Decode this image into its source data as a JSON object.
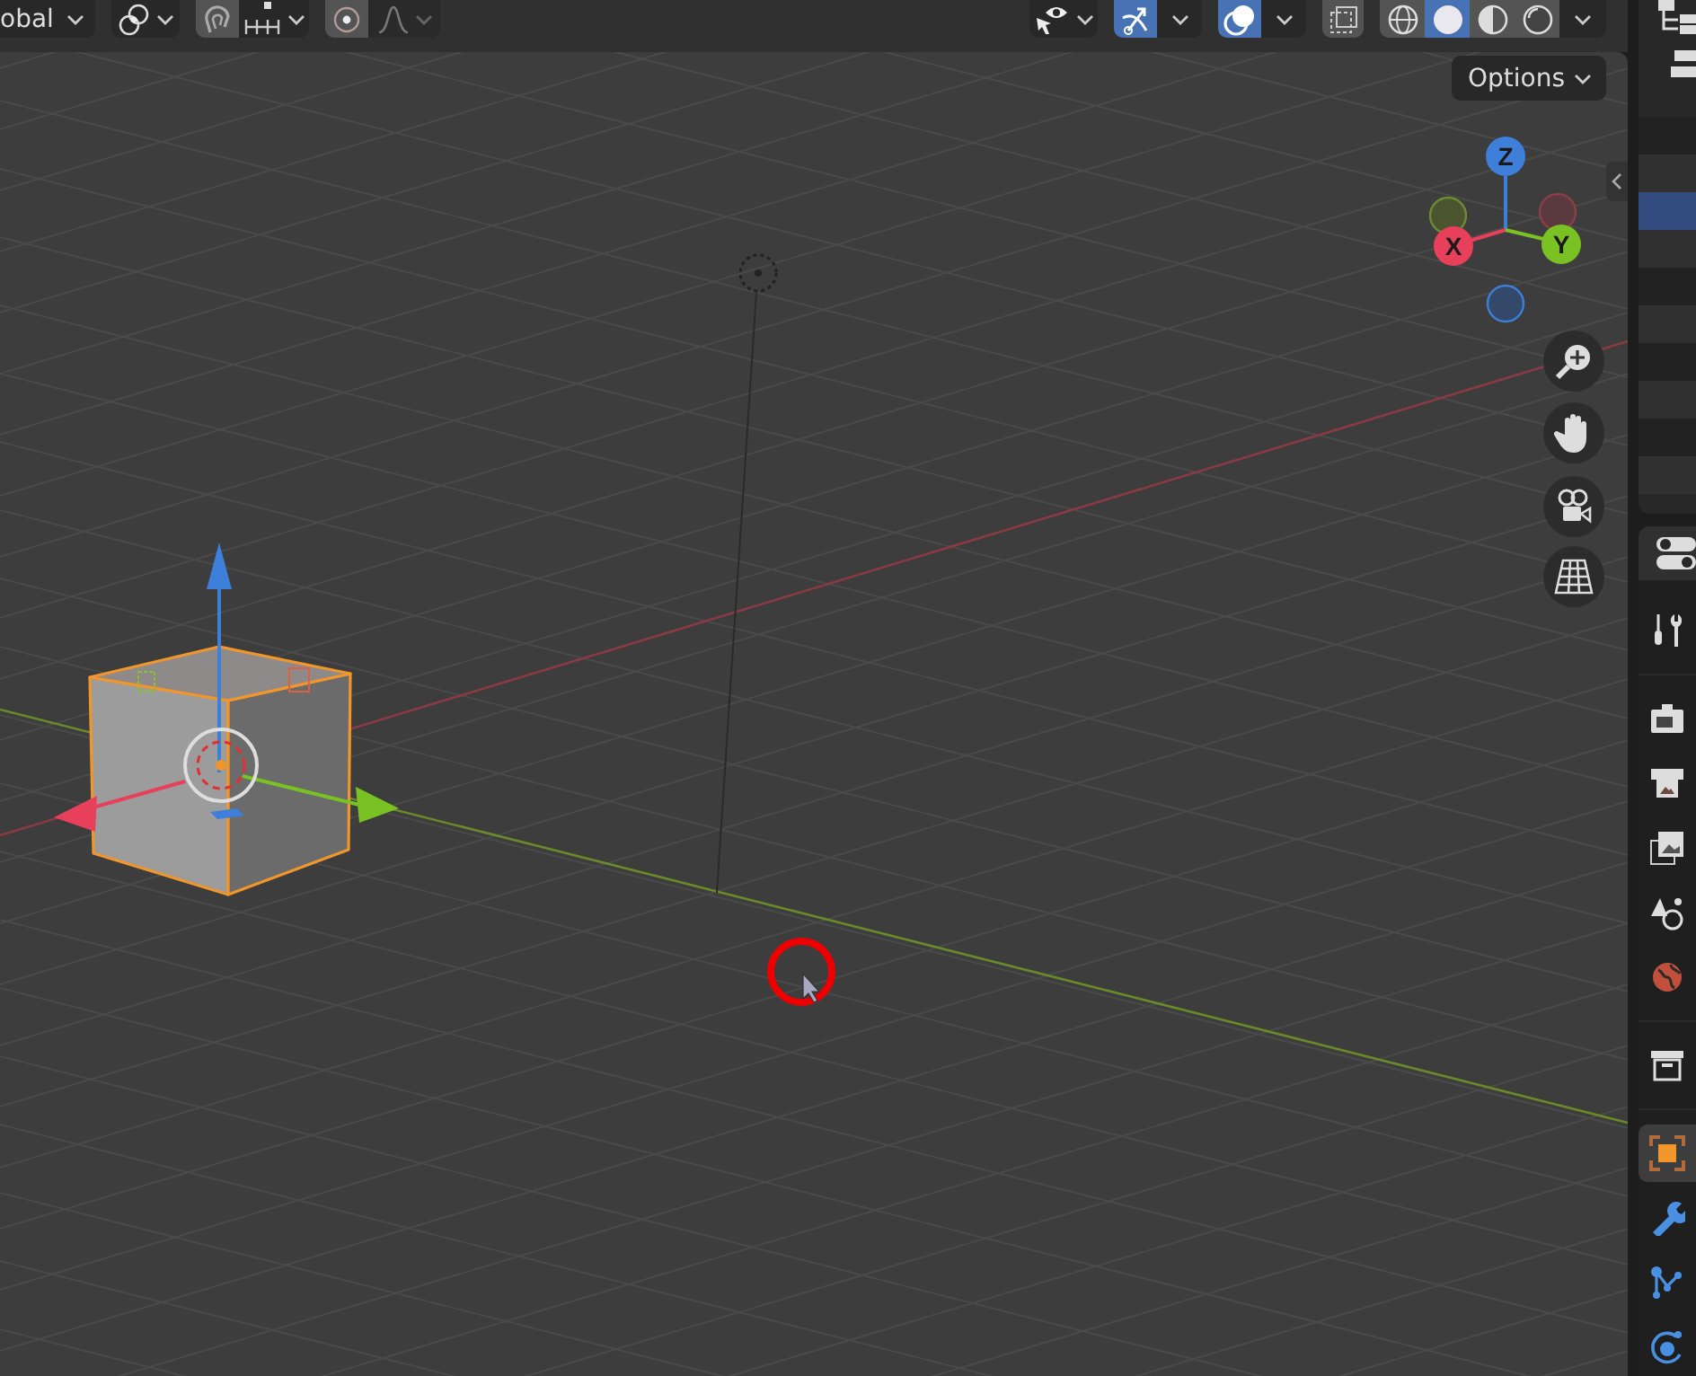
{
  "header": {
    "left": [
      {
        "kind": "orientation",
        "label": "obal"
      },
      {
        "kind": "pivot"
      },
      {
        "kind": "snap",
        "on": false
      },
      {
        "kind": "proportional",
        "on": false
      }
    ],
    "right": [
      {
        "kind": "visibility"
      },
      {
        "kind": "gizmo",
        "on": true
      },
      {
        "kind": "overlay",
        "on": true
      },
      {
        "kind": "xray",
        "on": false
      }
    ],
    "shading": [
      {
        "kind": "wireframe",
        "selected": false
      },
      {
        "kind": "solid",
        "selected": true
      },
      {
        "kind": "material",
        "selected": false
      },
      {
        "kind": "rendered",
        "selected": false
      }
    ]
  },
  "viewport": {
    "options_label": "Options",
    "axes": [
      {
        "label": "Z"
      },
      {
        "label": "X"
      },
      {
        "label": "Y"
      }
    ],
    "nav_buttons": [
      {
        "kind": "zoom"
      },
      {
        "kind": "pan"
      },
      {
        "kind": "camera"
      },
      {
        "kind": "ortho"
      }
    ]
  },
  "outliner": {
    "rows": [
      {
        "selected": false
      },
      {
        "selected": false
      },
      {
        "selected": true
      },
      {
        "selected": false
      },
      {
        "selected": false
      },
      {
        "selected": false
      },
      {
        "selected": false
      },
      {
        "selected": false
      },
      {
        "selected": false
      },
      {
        "selected": false
      }
    ]
  },
  "properties_tabs": [
    {
      "kind": "tool",
      "selected": false
    },
    {
      "kind": "render",
      "selected": false
    },
    {
      "kind": "output",
      "selected": false
    },
    {
      "kind": "view_layer",
      "selected": false
    },
    {
      "kind": "scene",
      "selected": false
    },
    {
      "kind": "world",
      "selected": false
    },
    {
      "kind": "collection",
      "selected": false
    },
    {
      "kind": "object",
      "selected": true
    },
    {
      "kind": "modifier",
      "selected": false
    },
    {
      "kind": "particles",
      "selected": false
    },
    {
      "kind": "physics",
      "selected": false
    }
  ]
}
